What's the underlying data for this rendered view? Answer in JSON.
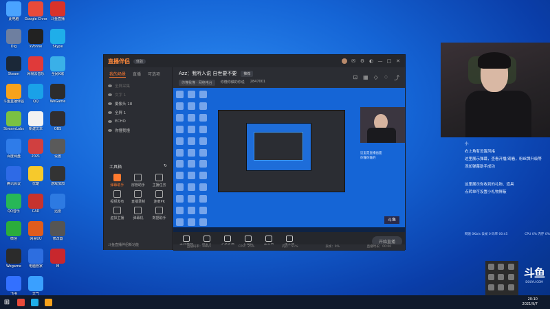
{
  "desktop": {
    "icons": [
      {
        "label": "此电脑",
        "color": "#4aa3ff"
      },
      {
        "label": "Google Chrome",
        "color": "#e84a3a"
      },
      {
        "label": "斗鱼直播",
        "color": "#d8322a"
      },
      {
        "label": "Dlg",
        "color": "#6e7fa0"
      },
      {
        "label": "xVonne",
        "color": "#222222"
      },
      {
        "label": "Skype",
        "color": "#1faee9"
      },
      {
        "label": "Steam",
        "color": "#1b2838"
      },
      {
        "label": "网易云音乐",
        "color": "#e03a3a"
      },
      {
        "label": "全民K歌",
        "color": "#3ab0e8"
      },
      {
        "label": "斗鱼直播伴侣",
        "color": "#f7a21b"
      },
      {
        "label": "QQ",
        "color": "#1aa1e8"
      },
      {
        "label": "WeGame",
        "color": "#2c2c2c"
      },
      {
        "label": "StreamLabs",
        "color": "#7ac143"
      },
      {
        "label": "新建文本",
        "color": "#f2f2f2"
      },
      {
        "label": "OBS",
        "color": "#302e31"
      },
      {
        "label": "百度网盘",
        "color": "#2f7ce9"
      },
      {
        "label": "2021",
        "color": "#d04040"
      },
      {
        "label": "设置",
        "color": "#5a5a5a"
      },
      {
        "label": "腾讯会议",
        "color": "#2e6ae6"
      },
      {
        "label": "优酷",
        "color": "#f6c92c"
      },
      {
        "label": "游戏加加",
        "color": "#333333"
      },
      {
        "label": "QQ音乐",
        "color": "#27b757"
      },
      {
        "label": "CAD",
        "color": "#c7332e"
      },
      {
        "label": "迅雷",
        "color": "#2d7ae2"
      },
      {
        "label": "微信",
        "color": "#2bad3b"
      },
      {
        "label": "网易UU",
        "color": "#e05c1d"
      },
      {
        "label": "修改器",
        "color": "#555555"
      },
      {
        "label": "Wegame",
        "color": "#2b2b2b"
      },
      {
        "label": "电脑管家",
        "color": "#2d6ee0"
      },
      {
        "label": "M",
        "color": "#c8272d"
      },
      {
        "label": "飞书",
        "color": "#3370ff"
      },
      {
        "label": "天气",
        "color": "#3aa0ff"
      }
    ]
  },
  "app": {
    "logo": "直播伴侣",
    "badge": "体验",
    "tabs": [
      "我的场景",
      "直播",
      "可选项"
    ],
    "sources": [
      {
        "label": "全屏采集"
      },
      {
        "label": "文字 1"
      },
      {
        "label": "摄像头 18"
      },
      {
        "label": "全屏 1"
      },
      {
        "label": "ECHO"
      },
      {
        "label": "你懂我懂"
      }
    ],
    "toolbox_title": "工具箱",
    "tools": [
      {
        "label": "弹幕助手",
        "hot": true
      },
      {
        "label": "房管助手",
        "hot": false
      },
      {
        "label": "主播任务",
        "hot": false
      },
      {
        "label": "视频发布",
        "hot": false
      },
      {
        "label": "直播录制",
        "hot": false
      },
      {
        "label": "连麦PK",
        "hot": false
      },
      {
        "label": "虚拟主播",
        "hot": false
      },
      {
        "label": "弹幕机",
        "hot": false
      },
      {
        "label": "数据助手",
        "hot": false
      }
    ],
    "bottom_tip": "斗鱼直播伴侣新功能",
    "stream_title": "Azz：我听人说 自世要不要",
    "stream_tag": "推荐",
    "room_label": "你懂我懂 · 网络电台",
    "room_id": "2847001",
    "category": "你懂你做的你说",
    "controls": [
      {
        "label": "直播屏幕"
      },
      {
        "label": "摄像头"
      },
      {
        "label": "手机投屏"
      },
      {
        "label": "多媒体"
      },
      {
        "label": "麦克风"
      },
      {
        "label": "扬声器"
      }
    ],
    "start_button": "开始直播",
    "status": [
      "直播码率：0Kb/s",
      "CPU：25%",
      "内存：51%",
      "丢帧：0%",
      "直播时长：00:00"
    ]
  },
  "preview": {
    "caption_lines": [
      "这里是直播画面",
      "你懂你做的"
    ]
  },
  "info_text": {
    "lines": [
      "小",
      "右上角有设置风格",
      "这里展示弹幕，查看开播/观看，粉丝牌升级等",
      "添加弹幕助手成功",
      "",
      "这里展示你收到的礼物、道具",
      "点转单可设置小礼物屏蔽"
    ]
  },
  "stats": {
    "left": "网速 0Kb/s 丢帧 0 码率 00:45",
    "right": "CPU 0% 内存 0%"
  },
  "douyu": {
    "mark": "斗鱼",
    "sub": "DOUYU.COM"
  },
  "taskbar": {
    "time": "20:10",
    "date": "2021/9/7",
    "icons": [
      {
        "color": "#e84a3a"
      },
      {
        "color": "#1faee9"
      },
      {
        "color": "#f7a21b"
      }
    ]
  }
}
